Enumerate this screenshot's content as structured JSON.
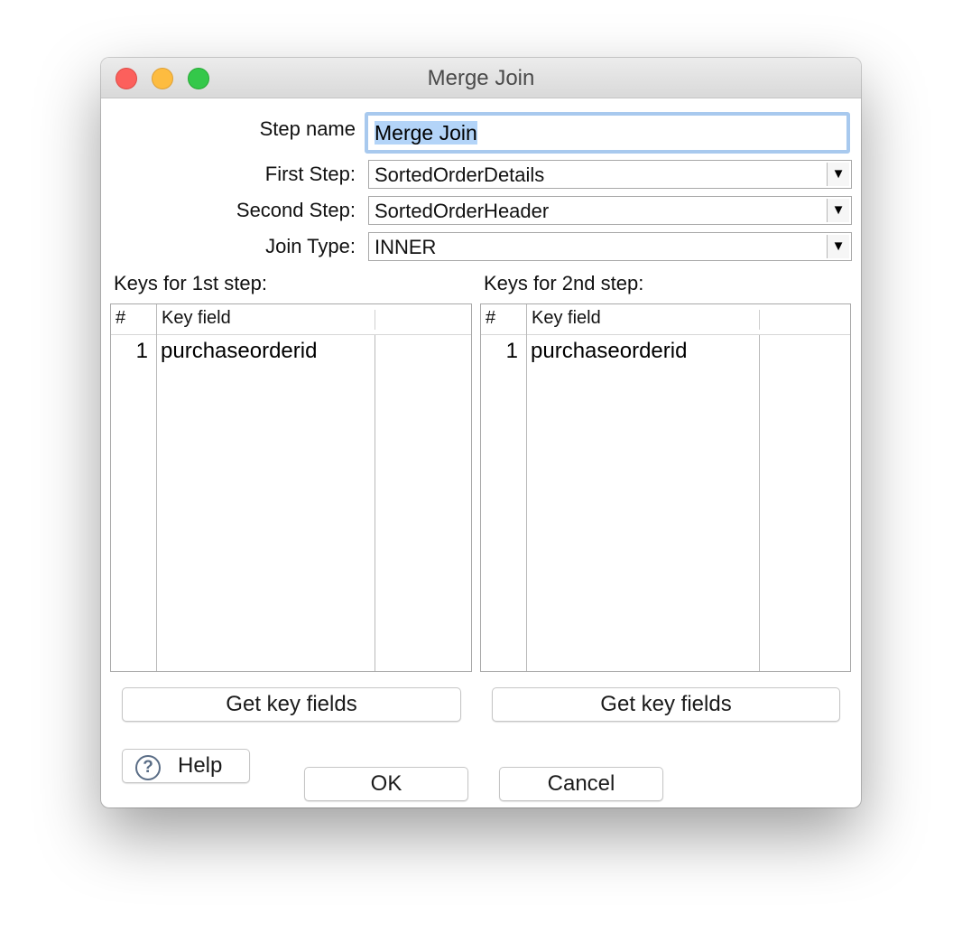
{
  "window": {
    "title": "Merge Join"
  },
  "form": {
    "step_name_label": "Step name",
    "step_name_value": "Merge Join",
    "first_step_label": "First Step:",
    "first_step_value": "SortedOrderDetails",
    "second_step_label": "Second Step:",
    "second_step_value": "SortedOrderHeader",
    "join_type_label": "Join Type:",
    "join_type_value": "INNER",
    "dropdown_arrow": "▼"
  },
  "keys_1": {
    "section_label": "Keys for 1st step:",
    "columns": [
      "#",
      "Key field"
    ],
    "rows": [
      {
        "num": "1",
        "field": "purchaseorderid"
      }
    ],
    "button_label": "Get key fields"
  },
  "keys_2": {
    "section_label": "Keys for 2nd step:",
    "columns": [
      "#",
      "Key field"
    ],
    "rows": [
      {
        "num": "1",
        "field": "purchaseorderid"
      }
    ],
    "button_label": "Get key fields"
  },
  "buttons": {
    "help_label": "Help",
    "help_icon_glyph": "?",
    "ok_label": "OK",
    "cancel_label": "Cancel"
  },
  "colors": {
    "close": "#fc605c",
    "minimize": "#fdbc40",
    "maximize": "#34c84a",
    "focus_ring": "#a8c9ee",
    "selection": "#b3d4f8"
  }
}
